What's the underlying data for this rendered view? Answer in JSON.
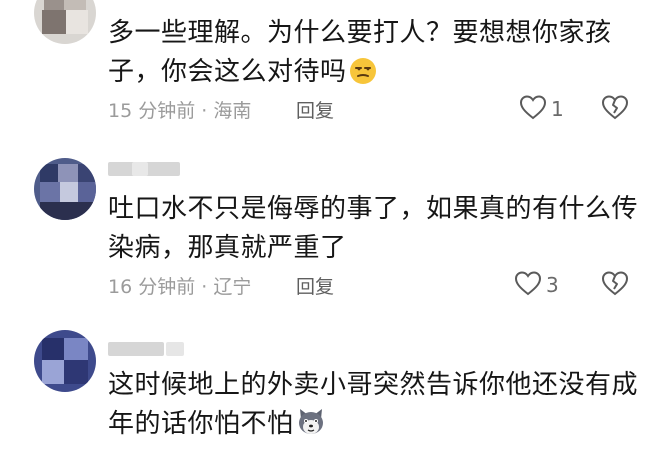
{
  "comments": [
    {
      "text": "多一些理解。为什么要打人？要想想你家孩子，你会这么对待吗",
      "emoji": "smirk-emoji",
      "meta": "15 分钟前 · 海南",
      "reply_label": "回复",
      "likes": "1"
    },
    {
      "text": "吐口水不只是侮辱的事了，如果真的有什么传染病，那真就严重了",
      "meta": "16 分钟前 · 辽宁",
      "reply_label": "回复",
      "likes": "3"
    },
    {
      "text": "这时候地上的外卖小哥突然告诉你他还没有成年的话你怕不怕",
      "emoji": "husky-dog-emoji",
      "meta": "",
      "reply_label": "",
      "likes": ""
    }
  ],
  "colors": {
    "meta_gray": "#9b9b9b",
    "text_black": "#161616",
    "icon_gray": "#5a5a5a"
  }
}
